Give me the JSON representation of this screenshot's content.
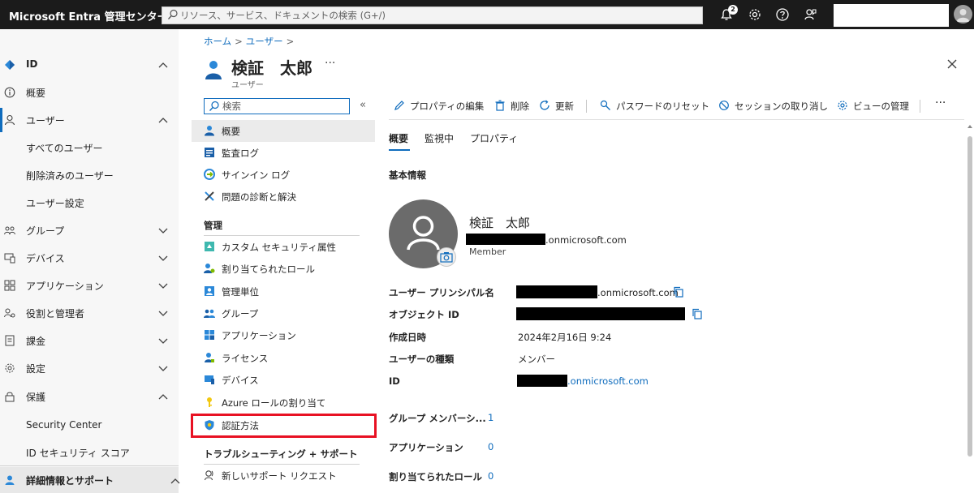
{
  "topbar": {
    "brand": "Microsoft Entra 管理センター",
    "search_placeholder": "リソース、サービス、ドキュメントの検索 (G+/)",
    "notification_count": "2"
  },
  "leftnav": {
    "items": [
      {
        "label": "ID",
        "icon": "diamond-icon",
        "chevron": "up"
      },
      {
        "label": "概要",
        "icon": "info-icon"
      },
      {
        "label": "ユーザー",
        "icon": "person-icon",
        "chevron": "up",
        "selected": true
      },
      {
        "label": "すべてのユーザー",
        "sub": true
      },
      {
        "label": "削除済みのユーザー",
        "sub": true
      },
      {
        "label": "ユーザー設定",
        "sub": true
      },
      {
        "label": "グループ",
        "icon": "group-icon",
        "chevron": "down"
      },
      {
        "label": "デバイス",
        "icon": "device-icon",
        "chevron": "down"
      },
      {
        "label": "アプリケーション",
        "icon": "apps-icon",
        "chevron": "down"
      },
      {
        "label": "役割と管理者",
        "icon": "roles-icon",
        "chevron": "down"
      },
      {
        "label": "課金",
        "icon": "billing-icon",
        "chevron": "down"
      },
      {
        "label": "設定",
        "icon": "settings-icon",
        "chevron": "down"
      },
      {
        "label": "保護",
        "icon": "lock-icon",
        "chevron": "up"
      },
      {
        "label": "Security Center",
        "sub": true
      },
      {
        "label": "ID セキュリティ スコア",
        "sub": true
      }
    ],
    "bottom": "詳細情報とサポート"
  },
  "breadcrumb": {
    "home": "ホーム",
    "users": "ユーザー"
  },
  "header": {
    "title": "検証　太郎",
    "subtitle": "ユーザー",
    "more": "···"
  },
  "menu": {
    "search_placeholder": "検索",
    "collapse": "«",
    "items_top": [
      {
        "label": "概要",
        "icon": "person-icon",
        "selected": true
      },
      {
        "label": "監査ログ",
        "icon": "audit-log-icon"
      },
      {
        "label": "サインイン ログ",
        "icon": "signin-log-icon"
      },
      {
        "label": "問題の診断と解決",
        "icon": "diagnose-icon"
      }
    ],
    "section_manage": "管理",
    "items_manage": [
      {
        "label": "カスタム セキュリティ属性",
        "icon": "custom-attr-icon"
      },
      {
        "label": "割り当てられたロール",
        "icon": "assigned-roles-icon"
      },
      {
        "label": "管理単位",
        "icon": "admin-unit-icon"
      },
      {
        "label": "グループ",
        "icon": "group-icon"
      },
      {
        "label": "アプリケーション",
        "icon": "apps-icon"
      },
      {
        "label": "ライセンス",
        "icon": "license-icon"
      },
      {
        "label": "デバイス",
        "icon": "device-icon"
      },
      {
        "label": "Azure ロールの割り当て",
        "icon": "key-icon"
      },
      {
        "label": "認証方法",
        "icon": "shield-icon"
      }
    ],
    "section_troubleshoot": "トラブルシューティング + サポート",
    "items_troubleshoot": [
      {
        "label": "新しいサポート リクエスト",
        "icon": "support-icon"
      }
    ]
  },
  "commands": {
    "edit": "プロパティの編集",
    "delete": "削除",
    "refresh": "更新",
    "reset_password": "パスワードのリセット",
    "revoke_sessions": "セッションの取り消し",
    "manage_view": "ビューの管理",
    "more": "···"
  },
  "tabs": [
    {
      "label": "概要",
      "active": true
    },
    {
      "label": "監視中"
    },
    {
      "label": "プロパティ"
    }
  ],
  "basic_info": {
    "heading": "基本情報",
    "display_name": "検証　太郎",
    "domain_suffix": ".onmicrosoft.com",
    "user_type_badge": "Member"
  },
  "properties": [
    {
      "key": "ユーザー プリンシパル名",
      "value": ".onmicrosoft.com"
    },
    {
      "key": "オブジェクト ID",
      "value": ""
    },
    {
      "key": "作成日時",
      "value": "2024年2月16日 9:24"
    },
    {
      "key": "ユーザーの種類",
      "value": "メンバー"
    },
    {
      "key": "ID",
      "value": ".onmicrosoft.com"
    }
  ],
  "counts": [
    {
      "key": "グループ メンバーシ...",
      "value": "1"
    },
    {
      "key": "アプリケーション",
      "value": "0"
    },
    {
      "key": "割り当てられたロール",
      "value": "0"
    }
  ]
}
